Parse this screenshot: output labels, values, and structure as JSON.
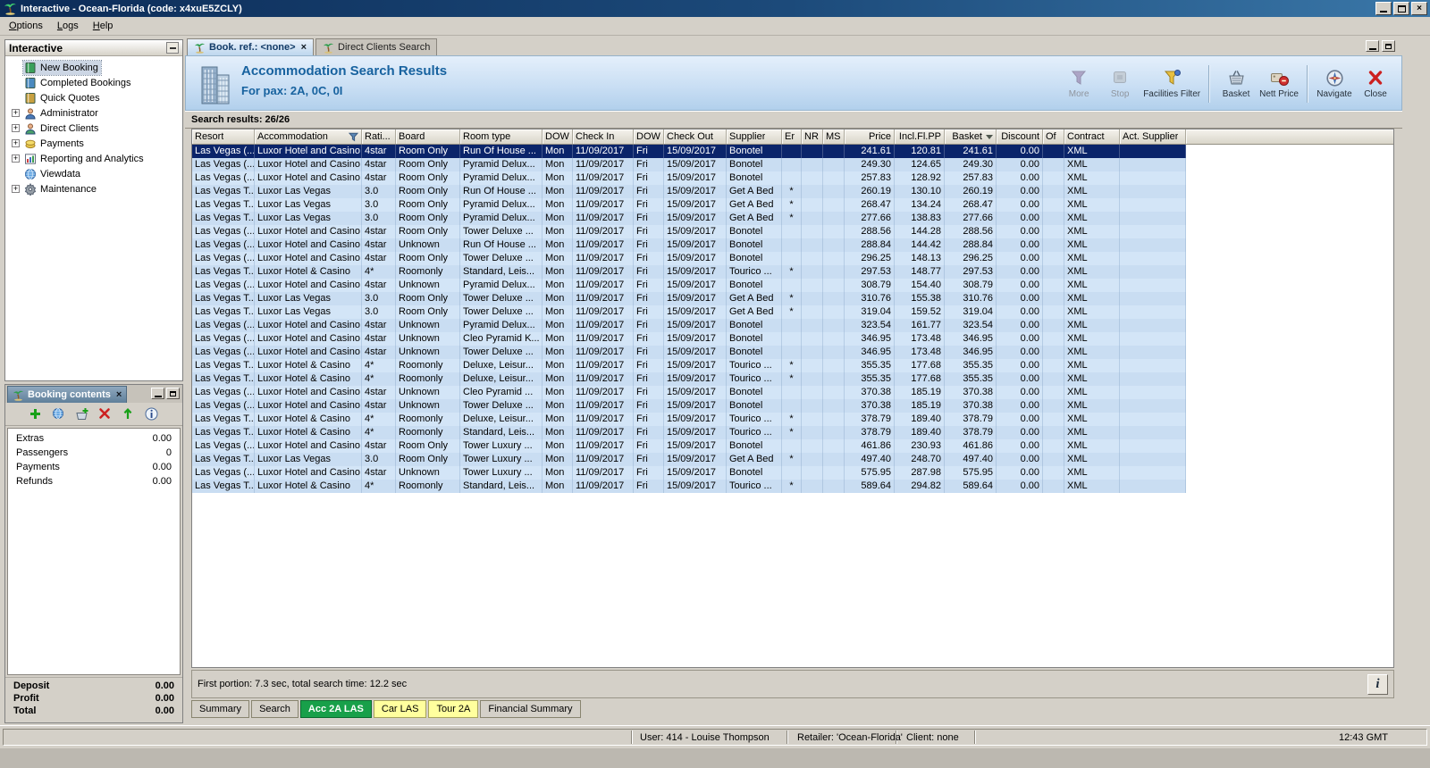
{
  "titlebar": {
    "title": "Interactive - Ocean-Florida (code: x4xuE5ZCLY)"
  },
  "menubar": {
    "items": [
      "Options",
      "Logs",
      "Help"
    ]
  },
  "sidebar": {
    "title": "Interactive",
    "items": [
      {
        "label": "New Booking",
        "icon": "new-booking-icon",
        "expandable": false,
        "selected": true
      },
      {
        "label": "Completed Bookings",
        "icon": "completed-bookings-icon",
        "expandable": false
      },
      {
        "label": "Quick Quotes",
        "icon": "quick-quotes-icon",
        "expandable": false
      },
      {
        "label": "Administrator",
        "icon": "administrator-icon",
        "expandable": true
      },
      {
        "label": "Direct Clients",
        "icon": "direct-clients-icon",
        "expandable": true
      },
      {
        "label": "Payments",
        "icon": "payments-icon",
        "expandable": true
      },
      {
        "label": "Reporting and Analytics",
        "icon": "reporting-icon",
        "expandable": true
      },
      {
        "label": "Viewdata",
        "icon": "viewdata-icon",
        "expandable": false
      },
      {
        "label": "Maintenance",
        "icon": "maintenance-icon",
        "expandable": true
      }
    ]
  },
  "booking_contents": {
    "title": "Booking contents",
    "toolbar": [
      "add",
      "world",
      "basket-add",
      "delete",
      "move-up",
      "info"
    ],
    "rows": [
      {
        "label": "Extras",
        "value": "0.00"
      },
      {
        "label": "Passengers",
        "value": "0"
      },
      {
        "label": "Payments",
        "value": "0.00"
      },
      {
        "label": "Refunds",
        "value": "0.00"
      }
    ],
    "totals": [
      {
        "label": "Deposit",
        "value": "0.00"
      },
      {
        "label": "Profit",
        "value": "0.00"
      },
      {
        "label": "Total",
        "value": "0.00"
      }
    ]
  },
  "main": {
    "tabs": [
      {
        "label": "Book. ref.: <none>",
        "active": true,
        "closable": true
      },
      {
        "label": "Direct Clients Search",
        "active": false,
        "closable": false
      }
    ],
    "header": {
      "title": "Accommodation Search Results",
      "subtitle": "For pax: 2A, 0C, 0I"
    },
    "toolbar": [
      {
        "label": "More",
        "icon": "more-filter-icon",
        "disabled": true
      },
      {
        "label": "Stop",
        "icon": "stop-icon",
        "disabled": true
      },
      {
        "label": "Facilities Filter",
        "icon": "facilities-filter-icon",
        "disabled": false
      },
      {
        "label": "Basket",
        "icon": "basket-icon",
        "disabled": false,
        "sep_before": true
      },
      {
        "label": "Nett Price",
        "icon": "nett-price-icon",
        "disabled": false
      },
      {
        "label": "Navigate",
        "icon": "navigate-icon",
        "disabled": false,
        "sep_before": true
      },
      {
        "label": "Close",
        "icon": "close-icon",
        "disabled": false
      }
    ],
    "results_label": "Search results: 26/26",
    "table": {
      "sorted_column": "Basket",
      "selected_row": 0,
      "columns": [
        "Resort",
        "Accommodation",
        "Rati...",
        "Board",
        "Room type",
        "DOW",
        "Check In",
        "DOW",
        "Check Out",
        "Supplier",
        "Er",
        "NR",
        "MS",
        "Price",
        "Incl.Fl.PP",
        "Basket",
        "Discount",
        "Of",
        "Contract",
        "Act. Supplier"
      ],
      "rows": [
        [
          "Las Vegas (...",
          "Luxor Hotel and Casino",
          "4star",
          "Room Only",
          "Run Of House ...",
          "Mon",
          "11/09/2017",
          "Fri",
          "15/09/2017",
          "Bonotel",
          "",
          "",
          "",
          "241.61",
          "120.81",
          "241.61",
          "0.00",
          "",
          "XML",
          ""
        ],
        [
          "Las Vegas (...",
          "Luxor Hotel and Casino",
          "4star",
          "Room Only",
          "Pyramid Delux...",
          "Mon",
          "11/09/2017",
          "Fri",
          "15/09/2017",
          "Bonotel",
          "",
          "",
          "",
          "249.30",
          "124.65",
          "249.30",
          "0.00",
          "",
          "XML",
          ""
        ],
        [
          "Las Vegas (...",
          "Luxor Hotel and Casino",
          "4star",
          "Room Only",
          "Pyramid Delux...",
          "Mon",
          "11/09/2017",
          "Fri",
          "15/09/2017",
          "Bonotel",
          "",
          "",
          "",
          "257.83",
          "128.92",
          "257.83",
          "0.00",
          "",
          "XML",
          ""
        ],
        [
          "Las Vegas T...",
          "Luxor Las Vegas",
          "3.0",
          "Room Only",
          "Run Of House ...",
          "Mon",
          "11/09/2017",
          "Fri",
          "15/09/2017",
          "Get A Bed",
          "*",
          "",
          "",
          "260.19",
          "130.10",
          "260.19",
          "0.00",
          "",
          "XML",
          ""
        ],
        [
          "Las Vegas T...",
          "Luxor Las Vegas",
          "3.0",
          "Room Only",
          "Pyramid Delux...",
          "Mon",
          "11/09/2017",
          "Fri",
          "15/09/2017",
          "Get A Bed",
          "*",
          "",
          "",
          "268.47",
          "134.24",
          "268.47",
          "0.00",
          "",
          "XML",
          ""
        ],
        [
          "Las Vegas T...",
          "Luxor Las Vegas",
          "3.0",
          "Room Only",
          "Pyramid Delux...",
          "Mon",
          "11/09/2017",
          "Fri",
          "15/09/2017",
          "Get A Bed",
          "*",
          "",
          "",
          "277.66",
          "138.83",
          "277.66",
          "0.00",
          "",
          "XML",
          ""
        ],
        [
          "Las Vegas (...",
          "Luxor Hotel and Casino",
          "4star",
          "Room Only",
          "Tower Deluxe ...",
          "Mon",
          "11/09/2017",
          "Fri",
          "15/09/2017",
          "Bonotel",
          "",
          "",
          "",
          "288.56",
          "144.28",
          "288.56",
          "0.00",
          "",
          "XML",
          ""
        ],
        [
          "Las Vegas (...",
          "Luxor Hotel and Casino",
          "4star",
          "Unknown",
          "Run Of House ...",
          "Mon",
          "11/09/2017",
          "Fri",
          "15/09/2017",
          "Bonotel",
          "",
          "",
          "",
          "288.84",
          "144.42",
          "288.84",
          "0.00",
          "",
          "XML",
          ""
        ],
        [
          "Las Vegas (...",
          "Luxor Hotel and Casino",
          "4star",
          "Room Only",
          "Tower Deluxe ...",
          "Mon",
          "11/09/2017",
          "Fri",
          "15/09/2017",
          "Bonotel",
          "",
          "",
          "",
          "296.25",
          "148.13",
          "296.25",
          "0.00",
          "",
          "XML",
          ""
        ],
        [
          "Las Vegas T...",
          "Luxor Hotel & Casino",
          "4*",
          "Roomonly",
          "Standard, Leis...",
          "Mon",
          "11/09/2017",
          "Fri",
          "15/09/2017",
          "Tourico ...",
          "*",
          "",
          "",
          "297.53",
          "148.77",
          "297.53",
          "0.00",
          "",
          "XML",
          ""
        ],
        [
          "Las Vegas (...",
          "Luxor Hotel and Casino",
          "4star",
          "Unknown",
          "Pyramid Delux...",
          "Mon",
          "11/09/2017",
          "Fri",
          "15/09/2017",
          "Bonotel",
          "",
          "",
          "",
          "308.79",
          "154.40",
          "308.79",
          "0.00",
          "",
          "XML",
          ""
        ],
        [
          "Las Vegas T...",
          "Luxor Las Vegas",
          "3.0",
          "Room Only",
          "Tower Deluxe ...",
          "Mon",
          "11/09/2017",
          "Fri",
          "15/09/2017",
          "Get A Bed",
          "*",
          "",
          "",
          "310.76",
          "155.38",
          "310.76",
          "0.00",
          "",
          "XML",
          ""
        ],
        [
          "Las Vegas T...",
          "Luxor Las Vegas",
          "3.0",
          "Room Only",
          "Tower Deluxe ...",
          "Mon",
          "11/09/2017",
          "Fri",
          "15/09/2017",
          "Get A Bed",
          "*",
          "",
          "",
          "319.04",
          "159.52",
          "319.04",
          "0.00",
          "",
          "XML",
          ""
        ],
        [
          "Las Vegas (...",
          "Luxor Hotel and Casino",
          "4star",
          "Unknown",
          "Pyramid Delux...",
          "Mon",
          "11/09/2017",
          "Fri",
          "15/09/2017",
          "Bonotel",
          "",
          "",
          "",
          "323.54",
          "161.77",
          "323.54",
          "0.00",
          "",
          "XML",
          ""
        ],
        [
          "Las Vegas (...",
          "Luxor Hotel and Casino",
          "4star",
          "Unknown",
          "Cleo Pyramid K...",
          "Mon",
          "11/09/2017",
          "Fri",
          "15/09/2017",
          "Bonotel",
          "",
          "",
          "",
          "346.95",
          "173.48",
          "346.95",
          "0.00",
          "",
          "XML",
          ""
        ],
        [
          "Las Vegas (...",
          "Luxor Hotel and Casino",
          "4star",
          "Unknown",
          "Tower Deluxe ...",
          "Mon",
          "11/09/2017",
          "Fri",
          "15/09/2017",
          "Bonotel",
          "",
          "",
          "",
          "346.95",
          "173.48",
          "346.95",
          "0.00",
          "",
          "XML",
          ""
        ],
        [
          "Las Vegas T...",
          "Luxor Hotel & Casino",
          "4*",
          "Roomonly",
          "Deluxe, Leisur...",
          "Mon",
          "11/09/2017",
          "Fri",
          "15/09/2017",
          "Tourico ...",
          "*",
          "",
          "",
          "355.35",
          "177.68",
          "355.35",
          "0.00",
          "",
          "XML",
          ""
        ],
        [
          "Las Vegas T...",
          "Luxor Hotel & Casino",
          "4*",
          "Roomonly",
          "Deluxe, Leisur...",
          "Mon",
          "11/09/2017",
          "Fri",
          "15/09/2017",
          "Tourico ...",
          "*",
          "",
          "",
          "355.35",
          "177.68",
          "355.35",
          "0.00",
          "",
          "XML",
          ""
        ],
        [
          "Las Vegas (...",
          "Luxor Hotel and Casino",
          "4star",
          "Unknown",
          "Cleo Pyramid ...",
          "Mon",
          "11/09/2017",
          "Fri",
          "15/09/2017",
          "Bonotel",
          "",
          "",
          "",
          "370.38",
          "185.19",
          "370.38",
          "0.00",
          "",
          "XML",
          ""
        ],
        [
          "Las Vegas (...",
          "Luxor Hotel and Casino",
          "4star",
          "Unknown",
          "Tower Deluxe ...",
          "Mon",
          "11/09/2017",
          "Fri",
          "15/09/2017",
          "Bonotel",
          "",
          "",
          "",
          "370.38",
          "185.19",
          "370.38",
          "0.00",
          "",
          "XML",
          ""
        ],
        [
          "Las Vegas T...",
          "Luxor Hotel & Casino",
          "4*",
          "Roomonly",
          "Deluxe, Leisur...",
          "Mon",
          "11/09/2017",
          "Fri",
          "15/09/2017",
          "Tourico ...",
          "*",
          "",
          "",
          "378.79",
          "189.40",
          "378.79",
          "0.00",
          "",
          "XML",
          ""
        ],
        [
          "Las Vegas T...",
          "Luxor Hotel & Casino",
          "4*",
          "Roomonly",
          "Standard, Leis...",
          "Mon",
          "11/09/2017",
          "Fri",
          "15/09/2017",
          "Tourico ...",
          "*",
          "",
          "",
          "378.79",
          "189.40",
          "378.79",
          "0.00",
          "",
          "XML",
          ""
        ],
        [
          "Las Vegas (...",
          "Luxor Hotel and Casino",
          "4star",
          "Room Only",
          "Tower Luxury ...",
          "Mon",
          "11/09/2017",
          "Fri",
          "15/09/2017",
          "Bonotel",
          "",
          "",
          "",
          "461.86",
          "230.93",
          "461.86",
          "0.00",
          "",
          "XML",
          ""
        ],
        [
          "Las Vegas T...",
          "Luxor Las Vegas",
          "3.0",
          "Room Only",
          "Tower Luxury ...",
          "Mon",
          "11/09/2017",
          "Fri",
          "15/09/2017",
          "Get A Bed",
          "*",
          "",
          "",
          "497.40",
          "248.70",
          "497.40",
          "0.00",
          "",
          "XML",
          ""
        ],
        [
          "Las Vegas (...",
          "Luxor Hotel and Casino",
          "4star",
          "Unknown",
          "Tower Luxury ...",
          "Mon",
          "11/09/2017",
          "Fri",
          "15/09/2017",
          "Bonotel",
          "",
          "",
          "",
          "575.95",
          "287.98",
          "575.95",
          "0.00",
          "",
          "XML",
          ""
        ],
        [
          "Las Vegas T...",
          "Luxor Hotel & Casino",
          "4*",
          "Roomonly",
          "Standard, Leis...",
          "Mon",
          "11/09/2017",
          "Fri",
          "15/09/2017",
          "Tourico ...",
          "*",
          "",
          "",
          "589.64",
          "294.82",
          "589.64",
          "0.00",
          "",
          "XML",
          ""
        ]
      ]
    },
    "footer": {
      "status_text": "First portion: 7.3 sec, total search time: 12.2 sec",
      "info_button": "i"
    },
    "bottom_tabs": [
      {
        "label": "Summary",
        "style": "plain"
      },
      {
        "label": "Search",
        "style": "plain"
      },
      {
        "label": "Acc 2A LAS",
        "style": "green",
        "active": true
      },
      {
        "label": "Car LAS",
        "style": "yellow"
      },
      {
        "label": "Tour 2A",
        "style": "yellow"
      },
      {
        "label": "Financial Summary",
        "style": "plain"
      }
    ]
  },
  "statusbar": {
    "user": "User: 414 - Louise Thompson",
    "retailer": "Retailer: 'Ocean-Florida'",
    "client": "Client: none",
    "time": "12:43 GMT"
  },
  "colors": {
    "selected_row_bg": "#0a246a",
    "row_bg": "#cde1f5",
    "accent_blue": "#17629f",
    "tab_green": "#18a04a",
    "tab_yellow": "#ffff9e"
  }
}
